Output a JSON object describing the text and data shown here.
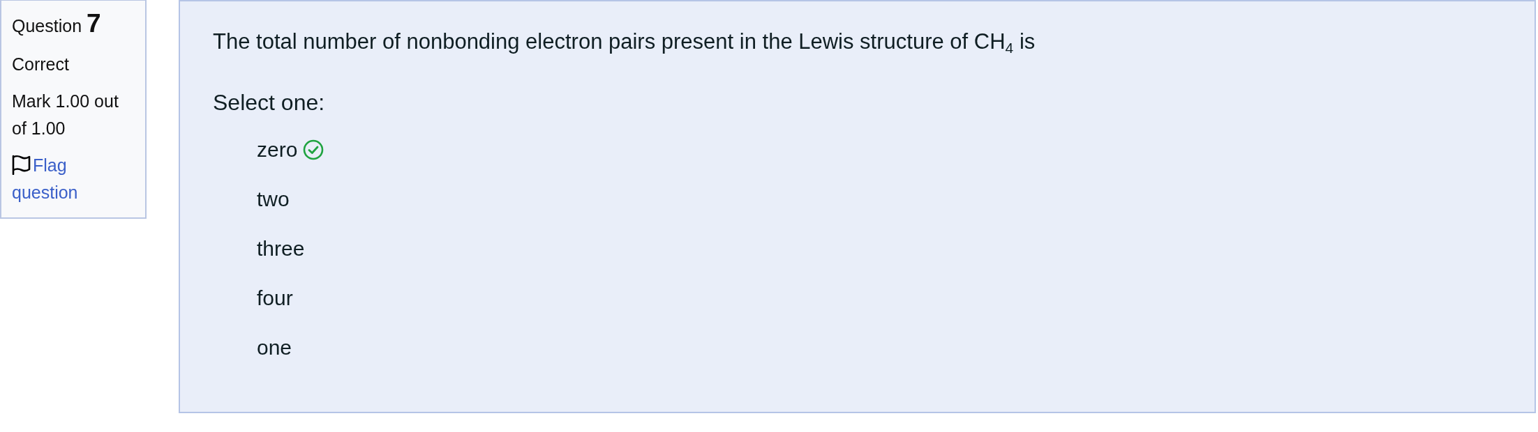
{
  "question_info": {
    "label": "Question",
    "number": "7",
    "state": "Correct",
    "mark": "Mark 1.00 out of 1.00",
    "flag_link": "Flag question"
  },
  "question": {
    "text": "The total number of nonbonding electron pairs present in the Lewis structure of CH$_{4}$ is",
    "prompt": "Select one:",
    "options": [
      {
        "label": "zero",
        "correct": true
      },
      {
        "label": "two",
        "correct": false
      },
      {
        "label": "three",
        "correct": false
      },
      {
        "label": "four",
        "correct": false
      },
      {
        "label": "one",
        "correct": false
      }
    ]
  }
}
